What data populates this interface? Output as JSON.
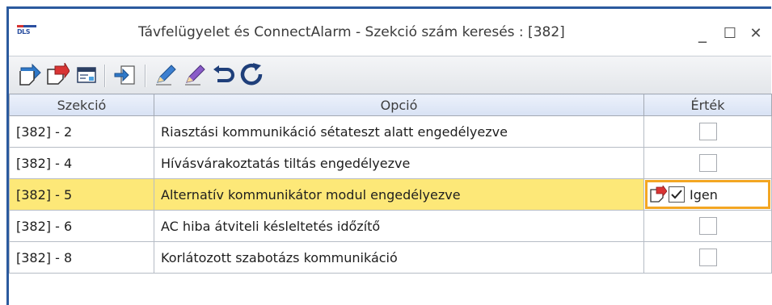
{
  "window": {
    "logo_text": "DLS",
    "title": "Távfelügyelet és ConnectAlarm - Szekció szám keresés : [382]",
    "minimize_glyph": "_",
    "maximize_glyph": "☐",
    "close_glyph": "✕"
  },
  "toolbar": {
    "buttons": [
      {
        "icon": "upload-icon"
      },
      {
        "icon": "download-icon"
      },
      {
        "icon": "window-icon"
      },
      {
        "icon": "import-icon"
      },
      {
        "icon": "edit-icon"
      },
      {
        "icon": "edit-alt-icon"
      },
      {
        "icon": "undo-icon"
      },
      {
        "icon": "refresh-icon"
      }
    ]
  },
  "grid": {
    "columns": [
      "Szekció",
      "Opció",
      "Érték"
    ],
    "rows": [
      {
        "section": "[382] - 2",
        "option": "Riasztási kommunikáció sétateszt alatt engedélyezve",
        "checked": false
      },
      {
        "section": "[382] - 4",
        "option": "Hívásvárakoztatás tiltás engedélyezve",
        "checked": false
      },
      {
        "section": "[382] - 5",
        "option": "Alternatív kommunikátor modul engedélyezve",
        "checked": true,
        "value_label": "Igen",
        "selected": true
      },
      {
        "section": "[382] - 6",
        "option": "AC hiba átviteli késleltetés időzítő",
        "checked": false
      },
      {
        "section": "[382] - 8",
        "option": "Korlátozott szabotázs kommunikáció",
        "checked": false
      }
    ]
  },
  "colors": {
    "selected_row": "#fde878",
    "editor_border": "#f3a623",
    "window_border": "#2b5a9e"
  }
}
